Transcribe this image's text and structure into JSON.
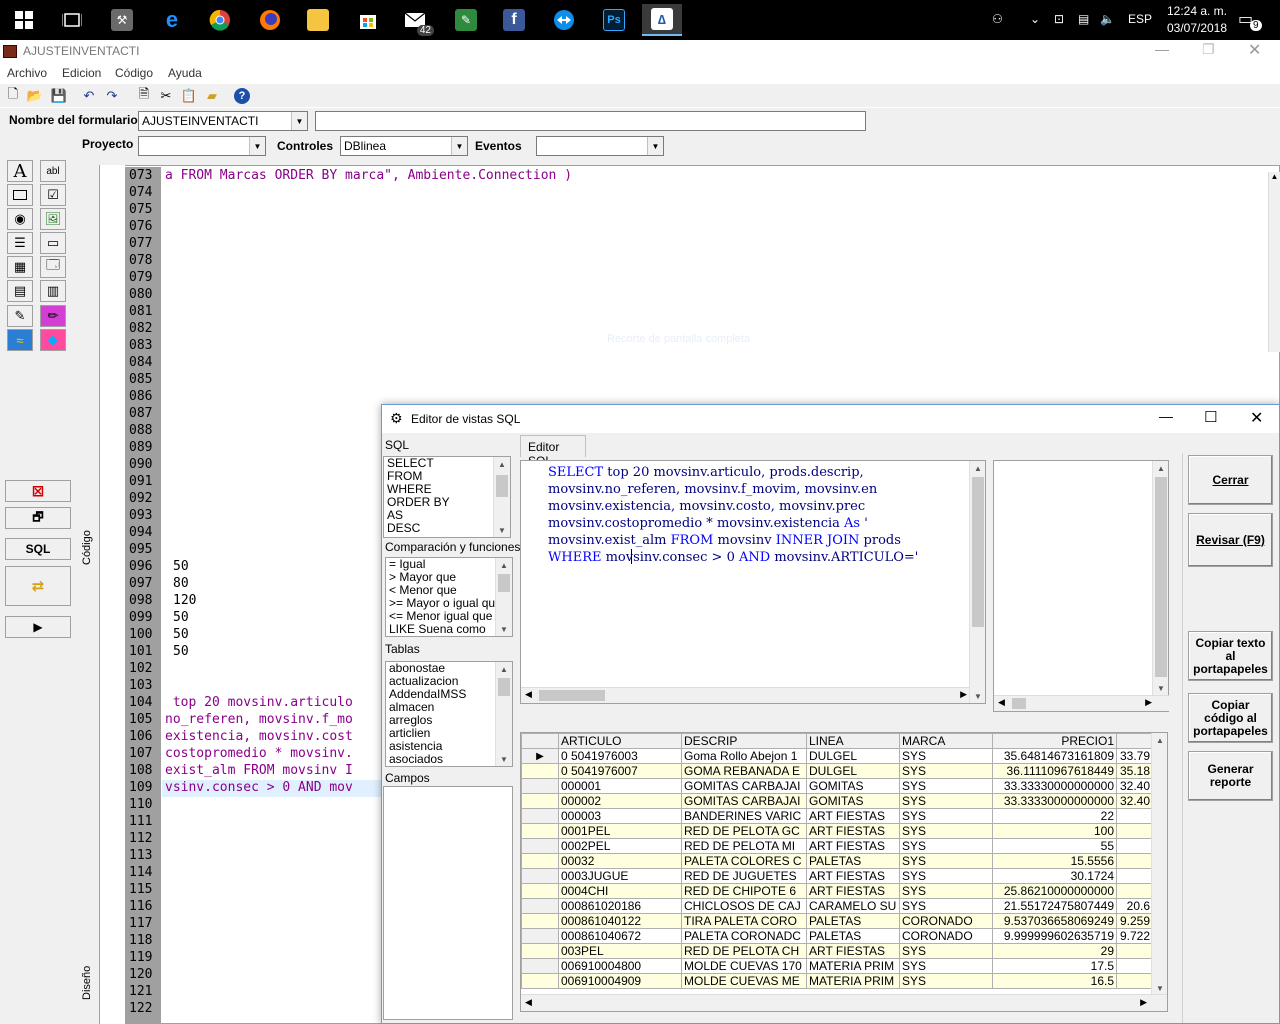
{
  "taskbar": {
    "mail_badge": "42",
    "tray_lang": "ESP",
    "clock_time": "12:24 a. m.",
    "clock_date": "03/07/2018",
    "notif_count": "9"
  },
  "window": {
    "title": "AJUSTEINVENTACTI",
    "menu": [
      "Archivo",
      "Edicion",
      "Código",
      "Ayuda"
    ]
  },
  "props": {
    "form_name_label": "Nombre del formulario",
    "form_name_value": "AJUSTEINVENTACTI",
    "project_label": "Proyecto",
    "controls_label": "Controles",
    "controls_value": "DBlinea",
    "events_label": "Eventos"
  },
  "palette": {
    "sql_button": "SQL"
  },
  "editor": {
    "tab_code": "Código",
    "tab_design": "Diseño",
    "line_numbers": [
      "073",
      "074",
      "075",
      "076",
      "077",
      "078",
      "079",
      "080",
      "081",
      "082",
      "083",
      "084",
      "085",
      "086",
      "087",
      "088",
      "089",
      "090",
      "091",
      "092",
      "093",
      "094",
      "095",
      "096",
      "097",
      "098",
      "099",
      "100",
      "101",
      "102",
      "103",
      "104",
      "105",
      "106",
      "107",
      "108",
      "109",
      "110",
      "111",
      "112",
      "113",
      "114",
      "115",
      "116",
      "117",
      "118",
      "119",
      "120",
      "121",
      "122"
    ],
    "ghost_text": "Recorte de pantalla completa",
    "line073": {
      "a": "a ",
      "b": "FROM",
      "c": " Marcas ",
      "d": "ORDER BY",
      "e": " marca\", Ambiente.Connection )"
    },
    "nums": {
      "l096": "50",
      "l097": "80",
      "l098": "120",
      "l099": "50",
      "l100": "50",
      "l101": "50"
    },
    "l104": " top 20 movsinv.articulo",
    "l105": "no_referen, movsinv.f_mo",
    "l106": "existencia, movsinv.cost",
    "l107": "costopromedio * movsinv.",
    "l108": "exist_alm FROM movsinv I",
    "l109": "vsinv.consec > 0 AND mov"
  },
  "dialog": {
    "title": "Editor de vistas SQL",
    "sql_label": "SQL",
    "sql_items": [
      "SELECT",
      "FROM",
      "WHERE",
      "ORDER BY",
      "AS",
      "DESC"
    ],
    "comp_label": "Comparación y funciones",
    "comp_items": [
      "=    Igual",
      ">    Mayor que",
      "<    Menor que",
      ">=  Mayor o igual que",
      "<=  Menor igual que",
      "LIKE Suena como"
    ],
    "tables_label": "Tablas",
    "tables_items": [
      "abonostae",
      "actualizacion",
      "AddendaIMSS",
      "almacen",
      "arreglos",
      "articlien",
      "asistencia",
      "asociados"
    ],
    "fields_label": "Campos",
    "tab_label": "Editor SQL",
    "sql_lines": [
      "SELECT top 20 movsinv.articulo, prods.descrip,",
      "movsinv.no_referen, movsinv.f_movim, movsinv.en",
      "movsinv.existencia, movsinv.costo, movsinv.prec",
      "movsinv.costopromedio * movsinv.existencia As '",
      "movsinv.exist_alm FROM movsinv INNER JOIN prods",
      "WHERE movsinv.consec > 0 AND movsinv.ARTICULO='"
    ],
    "buttons": {
      "close": "Cerrar",
      "review": "Revisar  (F9)",
      "copy_text_1": "Copiar texto",
      "copy_text_2": "al",
      "copy_text_3": "portapapeles",
      "copy_code_1": "Copiar",
      "copy_code_2": "código al",
      "copy_code_3": "portapapeles",
      "report_1": "Generar",
      "report_2": "reporte"
    },
    "grid": {
      "headers": [
        "ARTICULO",
        "DESCRIP",
        "LINEA",
        "MARCA",
        "PRECIO1",
        ""
      ],
      "rows": [
        [
          "0 5041976003",
          "Goma Rollo Abejon 1",
          "DULGEL",
          "SYS",
          "35.64814673161809",
          "33.79"
        ],
        [
          "0 5041976007",
          "GOMA REBANADA E",
          "DULGEL",
          "SYS",
          "36.11110967618449",
          "35.18"
        ],
        [
          "000001",
          "GOMITAS CARBAJAI",
          "GOMITAS",
          "SYS",
          "33.33330000000000",
          "32.40"
        ],
        [
          "000002",
          "GOMITAS CARBAJAI",
          "GOMITAS",
          "SYS",
          "33.33330000000000",
          "32.40"
        ],
        [
          "000003",
          "BANDERINES VARIC",
          "ART FIESTAS",
          "SYS",
          "22",
          ""
        ],
        [
          "0001PEL",
          "RED DE PELOTA GC",
          "ART FIESTAS",
          "SYS",
          "100",
          ""
        ],
        [
          "0002PEL",
          "RED DE PELOTA MI",
          "ART FIESTAS",
          "SYS",
          "55",
          ""
        ],
        [
          "00032",
          "PALETA COLORES C",
          "PALETAS",
          "SYS",
          "15.5556",
          ""
        ],
        [
          "0003JUGUE",
          "RED DE JUGUETES",
          "ART FIESTAS",
          "SYS",
          "30.1724",
          ""
        ],
        [
          "0004CHI",
          "RED DE CHIPOTE 6",
          "ART FIESTAS",
          "SYS",
          "25.86210000000000",
          ""
        ],
        [
          "000861020186",
          "CHICLOSOS DE CAJ",
          "CARAMELO SU",
          "SYS",
          "21.55172475807449",
          "20.6"
        ],
        [
          "000861040122",
          "TIRA PALETA CORO",
          "PALETAS",
          "CORONADO",
          "9.537036658069249",
          "9.259"
        ],
        [
          "000861040672",
          "PALETA CORONADC",
          "PALETAS",
          "CORONADO",
          "9.999999602635719",
          "9.722"
        ],
        [
          "003PEL",
          "RED DE PELOTA CH",
          "ART FIESTAS",
          "SYS",
          "29",
          ""
        ],
        [
          "006910004800",
          "MOLDE CUEVAS 170",
          "MATERIA PRIM",
          "SYS",
          "17.5",
          ""
        ],
        [
          "006910004909",
          "MOLDE CUEVAS ME",
          "MATERIA PRIM",
          "SYS",
          "16.5",
          ""
        ]
      ]
    }
  }
}
